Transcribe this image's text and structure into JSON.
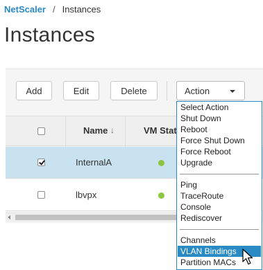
{
  "breadcrumb": {
    "root": "NetScaler",
    "separator": "/",
    "current": "Instances"
  },
  "page_title": "Instances",
  "toolbar": {
    "add_label": "Add",
    "edit_label": "Edit",
    "delete_label": "Delete",
    "action_label": "Action"
  },
  "table": {
    "columns": {
      "name": "Name",
      "vm_status": "VM Stat"
    },
    "rows": [
      {
        "name": "InternalA",
        "checked": true,
        "status_color": "#8dc63f"
      },
      {
        "name": "lbvpx",
        "checked": false,
        "status_color": "#8dc63f"
      }
    ]
  },
  "action_menu": {
    "group1": [
      "Select Action",
      "Shut Down",
      "Reboot",
      "Force Shut Down",
      "Force Reboot",
      "Upgrade"
    ],
    "group2": [
      "Ping",
      "TraceRoute",
      "Console",
      "Rediscover"
    ],
    "group3": [
      "Channels",
      "VLAN Bindings",
      "Partition MACs"
    ],
    "highlighted": "VLAN Bindings"
  },
  "colors": {
    "accent": "#2a8ac4",
    "selected_row": "#c9e2f0",
    "status_up": "#8dc63f"
  }
}
